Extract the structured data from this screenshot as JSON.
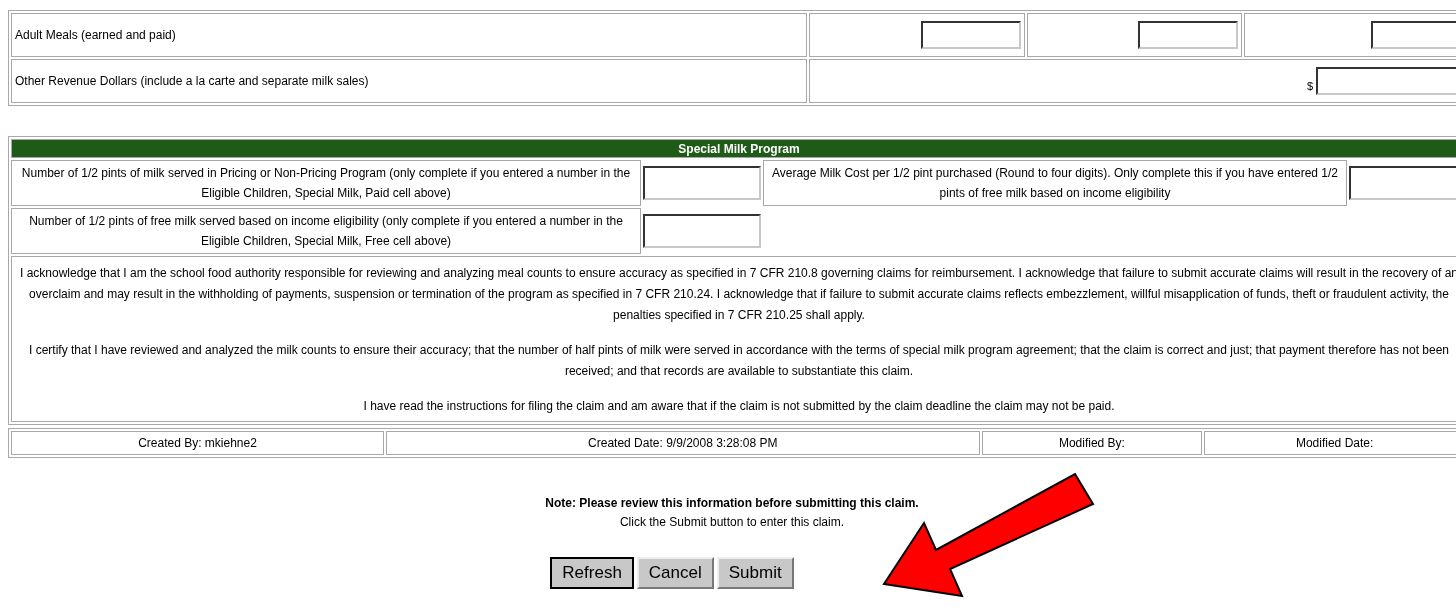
{
  "meals_table": {
    "rows": [
      {
        "kind": "three-inputs",
        "label": "Adult Meals (earned and paid)"
      },
      {
        "kind": "dollar-input",
        "label": "Other Revenue Dollars (include a la carte and separate milk sales)",
        "currency": "$"
      }
    ]
  },
  "milk_program": {
    "title": "Special Milk Program",
    "rows": [
      {
        "label": "Number of 1/2 pints of milk served in Pricing or Non-Pricing Program (only complete if you entered a number in the Eligible Children, Special Milk, Paid cell above)",
        "side_label": "Average Milk Cost per 1/2 pint purchased (Round to four digits). Only complete this if you have entered 1/2 pints of free milk based on income eligibility"
      },
      {
        "label": "Number of 1/2 pints of free milk served based on income eligibility (only complete if you entered a number in the Eligible Children, Special Milk, Free cell above)"
      }
    ],
    "acknowledgements": [
      "I acknowledge that I am the school food authority responsible for reviewing and analyzing meal counts to ensure accuracy as specified in 7 CFR 210.8 governing claims for reimbursement. I acknowledge that failure to submit accurate claims will result in the recovery of an overclaim and may result in the withholding of payments, suspension or termination of the program as specified in 7 CFR 210.24. I acknowledge that if failure to submit accurate claims reflects embezzlement, willful misapplication of funds, theft or fraudulent activity, the penalties specified in 7 CFR 210.25 shall apply.",
      "I certify that I have reviewed and analyzed the milk counts to ensure their accuracy; that the number of half pints of milk were served in accordance with the terms of special milk program agreement; that the claim is correct and just; that payment therefore has not been received; and that records are available to substantiate this claim.",
      "I have read the instructions for filing the claim and am aware that if the claim is not submitted by the claim deadline the claim may not be paid."
    ]
  },
  "audit": [
    "Created By: mkiehne2",
    "Created Date: 9/9/2008 3:28:08 PM",
    "Modified By:",
    "Modified Date:"
  ],
  "note": "Note: Please review this information before submitting this claim.",
  "instruction": "Click the Submit button to enter this claim.",
  "buttons": [
    {
      "label": "Refresh",
      "focused": true
    },
    {
      "label": "Cancel",
      "focused": false
    },
    {
      "label": "Submit",
      "focused": false
    }
  ]
}
